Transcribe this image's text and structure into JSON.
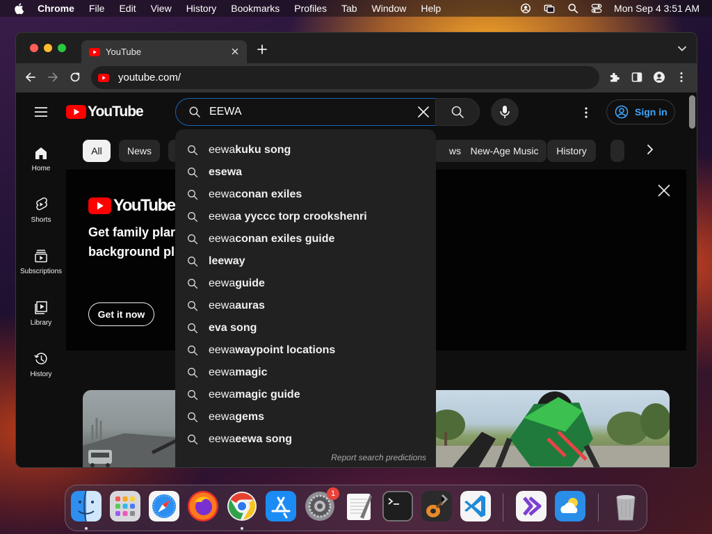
{
  "menubar": {
    "app": "Chrome",
    "items": [
      "File",
      "Edit",
      "View",
      "History",
      "Bookmarks",
      "Profiles",
      "Tab",
      "Window",
      "Help"
    ],
    "clock": "Mon Sep 4  3:51 AM"
  },
  "browser": {
    "tab_title": "YouTube",
    "url": "youtube.com/"
  },
  "youtube": {
    "logo_text": "YouTube",
    "search_value": "EEWA",
    "sign_in_label": "Sign in",
    "sidebar": [
      {
        "label": "Home",
        "icon": "home-icon"
      },
      {
        "label": "Shorts",
        "icon": "shorts-icon"
      },
      {
        "label": "Subscriptions",
        "icon": "subscriptions-icon"
      },
      {
        "label": "Library",
        "icon": "library-icon"
      },
      {
        "label": "History",
        "icon": "history-icon"
      }
    ],
    "chips": [
      "All",
      "News",
      "",
      "ws",
      "New-Age Music",
      "History",
      ""
    ],
    "banner": {
      "logo_text": "YouTube M",
      "line1": "Get family plar",
      "line2": "background pl",
      "cta": "Get it now"
    },
    "suggestions": [
      {
        "prefix": "eewa",
        "rest": " kuku song"
      },
      {
        "prefix": "",
        "rest": "esewa"
      },
      {
        "prefix": "eewa",
        "rest": " conan exiles"
      },
      {
        "prefix": "eewa",
        "rest": "a yyccc torp crookshenri"
      },
      {
        "prefix": "eewa",
        "rest": " conan exiles guide"
      },
      {
        "prefix": "",
        "rest": "leeway"
      },
      {
        "prefix": "eewa",
        "rest": " guide"
      },
      {
        "prefix": "eewa",
        "rest": " auras"
      },
      {
        "prefix": "",
        "rest": "eva song"
      },
      {
        "prefix": "eewa",
        "rest": " waypoint locations"
      },
      {
        "prefix": "eewa",
        "rest": " magic"
      },
      {
        "prefix": "eewa",
        "rest": " magic guide"
      },
      {
        "prefix": "eewa",
        "rest": " gems"
      },
      {
        "prefix": "eewa",
        "rest": " eewa song"
      }
    ],
    "report_label": "Report search predictions"
  },
  "dock": {
    "apps": [
      "Finder",
      "Launchpad",
      "Safari",
      "Firefox",
      "Chrome",
      "App Store",
      "System Settings",
      "TextEdit",
      "Terminal",
      "GarageBand",
      "Visual Studio Code",
      "Visual Studio",
      "Weather",
      "Trash"
    ],
    "settings_badge": "1"
  },
  "colors": {
    "accent": "#3ea6ff",
    "brand_red": "#ff0000",
    "page_bg": "#0f0f0f"
  }
}
